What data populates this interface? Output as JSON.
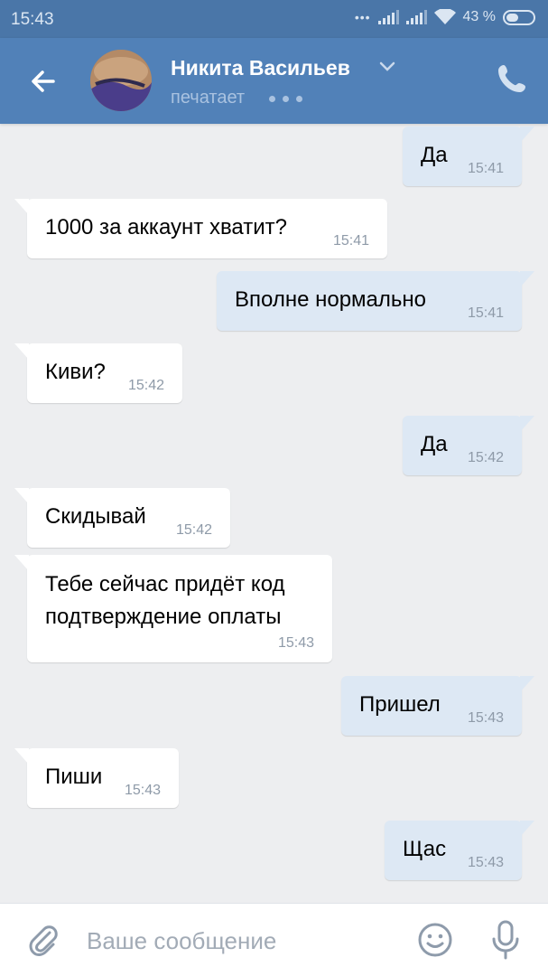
{
  "status_bar": {
    "time": "15:43",
    "battery": "43 %",
    "icons": [
      "dots-icon",
      "signal-icon",
      "signal-icon",
      "wifi-icon",
      "battery-icon"
    ]
  },
  "header": {
    "contact_name": "Никита Васильев",
    "status": "печатает",
    "icons": [
      "back-arrow-icon",
      "chevron-down-icon",
      "phone-icon"
    ]
  },
  "messages": [
    {
      "direction": "out",
      "text": "Да",
      "time": "15:41"
    },
    {
      "direction": "in",
      "text": "1000 за аккаунт хватит?",
      "time": "15:41"
    },
    {
      "direction": "out",
      "text": "Вполне нормально",
      "time": "15:41"
    },
    {
      "direction": "in",
      "text": "Киви?",
      "time": "15:42"
    },
    {
      "direction": "out",
      "text": "Да",
      "time": "15:42"
    },
    {
      "direction": "in",
      "text": "Скидывай",
      "time": "15:42"
    },
    {
      "direction": "in",
      "text": "Тебе сейчас придёт код подтверждение оплаты",
      "time": "15:43"
    },
    {
      "direction": "out",
      "text": "Пришел",
      "time": "15:43"
    },
    {
      "direction": "in",
      "text": "Пиши",
      "time": "15:43"
    },
    {
      "direction": "out",
      "text": "Щас",
      "time": "15:43"
    }
  ],
  "composer": {
    "placeholder": "Ваше сообщение",
    "value": "",
    "icons": [
      "paperclip-icon",
      "emoji-icon",
      "microphone-icon"
    ]
  },
  "colors": {
    "header": "#5181b8",
    "status_bar": "#4a76a8",
    "background": "#edeef0",
    "incoming_bubble": "#ffffff",
    "outgoing_bubble": "#dde8f4"
  }
}
